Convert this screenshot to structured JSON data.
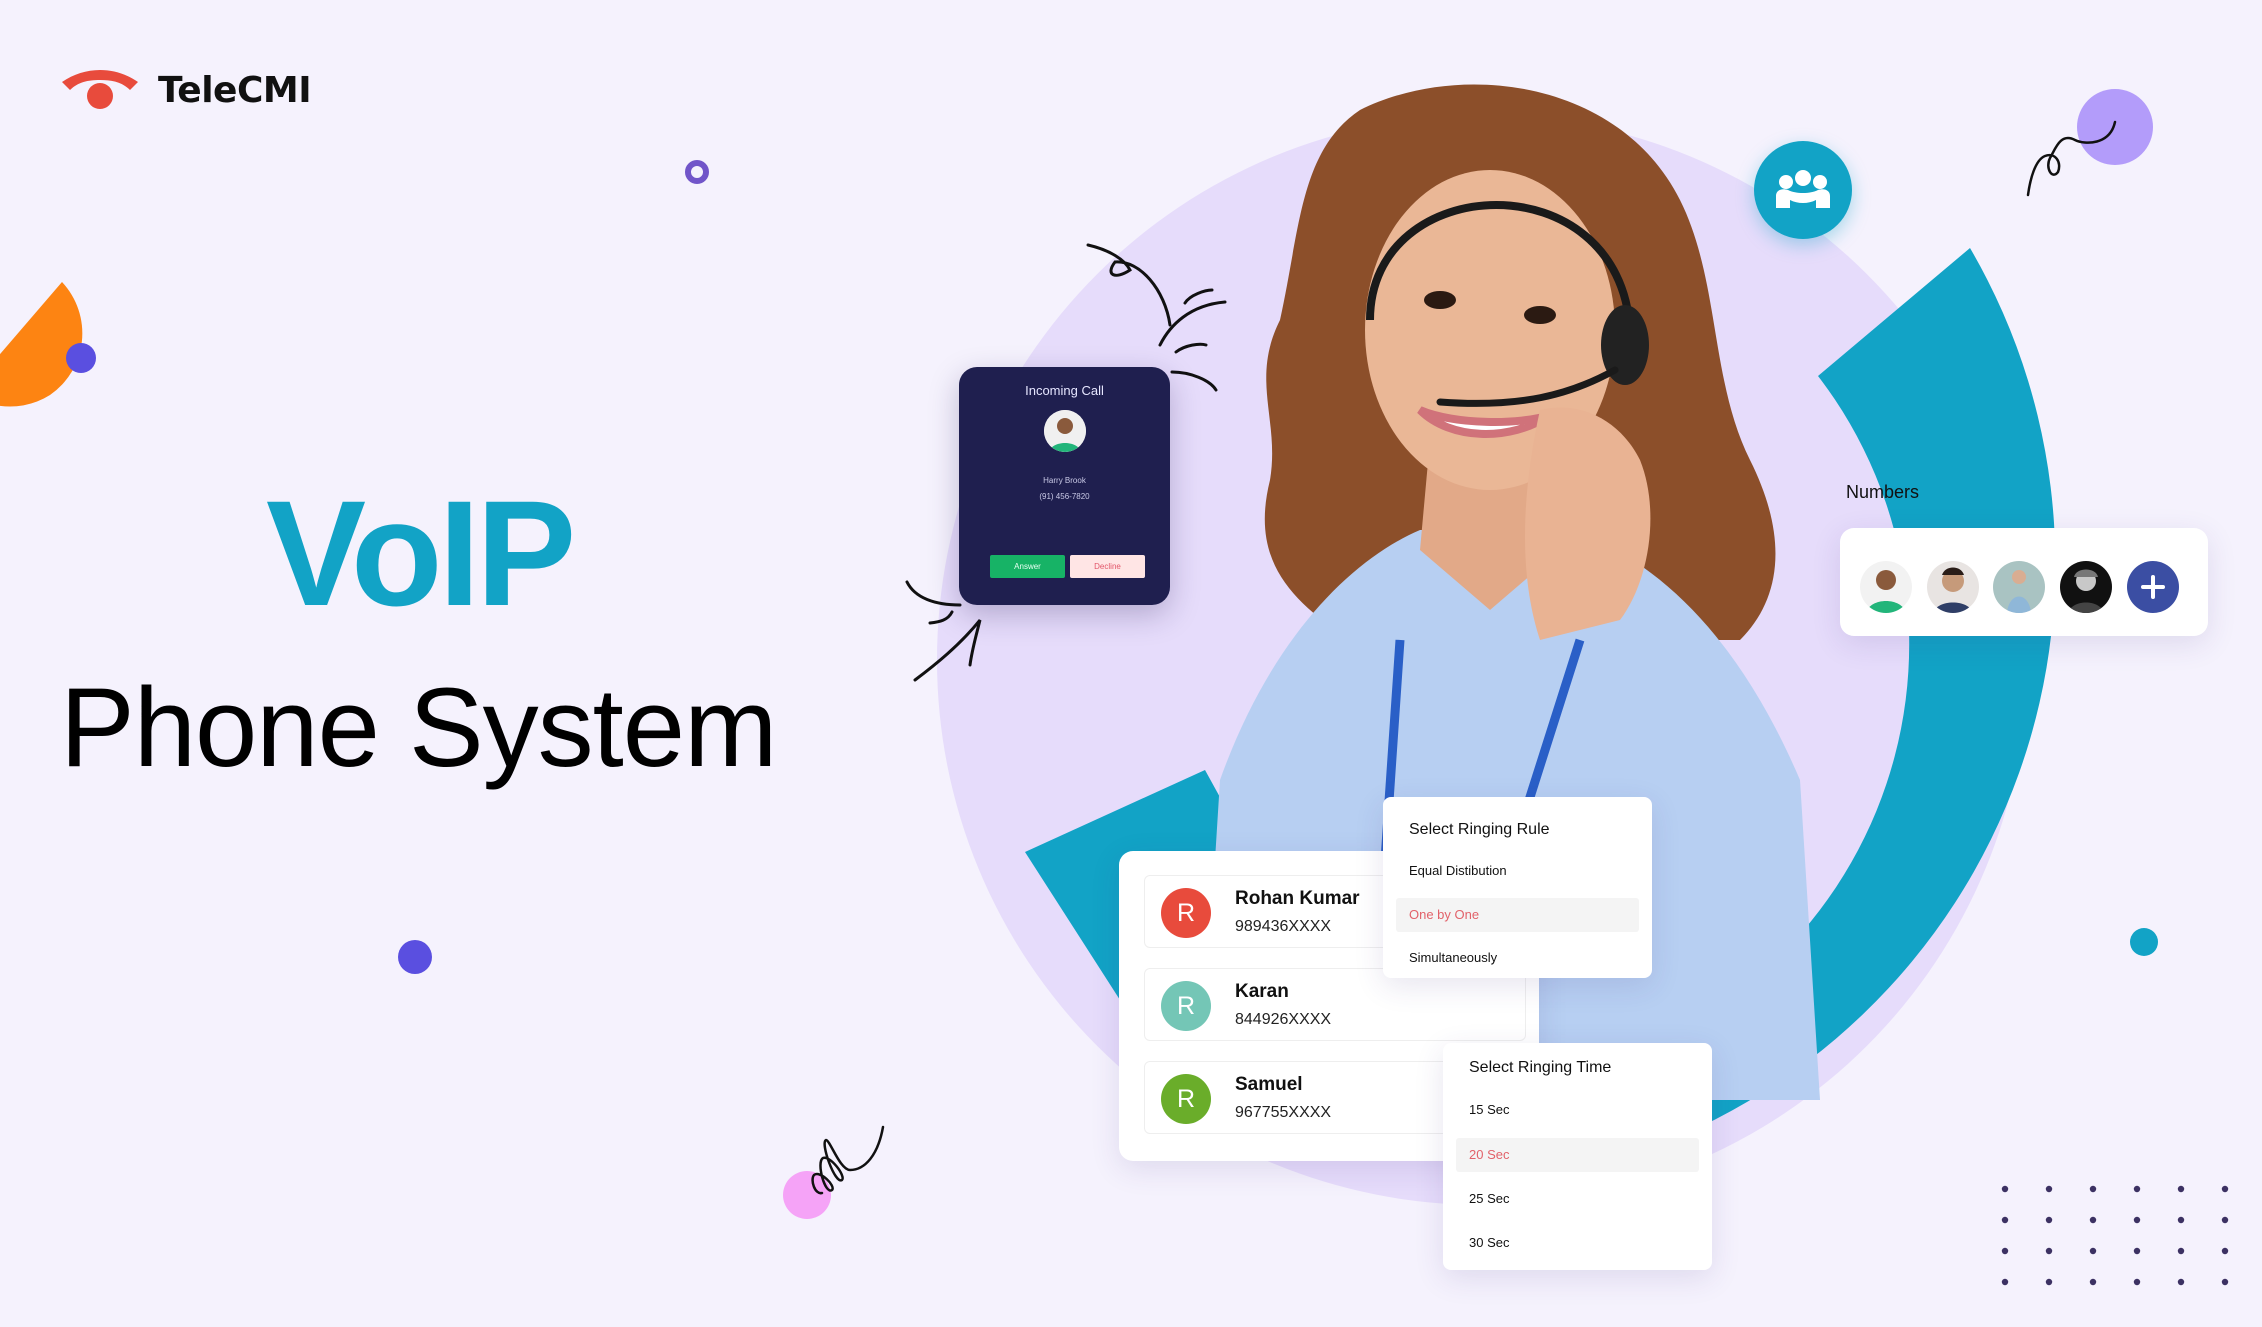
{
  "brand": {
    "name": "TeleCMI",
    "logo_icon": "phone-handset-icon",
    "logo_color": "#e84b3c"
  },
  "headline": {
    "line1": "VoIP",
    "line2": "Phone System",
    "accent_color": "#12a3c6"
  },
  "incoming_call": {
    "title": "Incoming Call",
    "caller_name": "Harry Brook",
    "caller_phone": "(91) 456-7820",
    "answer_label": "Answer",
    "decline_label": "Decline"
  },
  "numbers": {
    "label": "Numbers",
    "avatars": [
      "avatar-man-green-shirt",
      "avatar-man-beard",
      "avatar-woman-blue-blazer",
      "avatar-man-curly-bw"
    ],
    "add_icon": "plus-icon"
  },
  "contacts": [
    {
      "initial": "R",
      "name": "Rohan Kumar",
      "number": "989436XXXX",
      "color": "#e84b3c"
    },
    {
      "initial": "R",
      "name": "Karan",
      "number": "844926XXXX",
      "color": "#74c6b6"
    },
    {
      "initial": "R",
      "name": "Samuel",
      "number": "967755XXXX",
      "color": "#6aad2a"
    }
  ],
  "ringing_rule": {
    "title": "Select Ringing Rule",
    "options": [
      "Equal Distibution",
      "One by One",
      "Simultaneously"
    ],
    "selected": "One by One"
  },
  "ringing_time": {
    "title": "Select Ringing Time",
    "options": [
      "15 Sec",
      "20 Sec",
      "25 Sec",
      "30 Sec"
    ],
    "selected": "20 Sec"
  },
  "team_icon": "team-icon"
}
